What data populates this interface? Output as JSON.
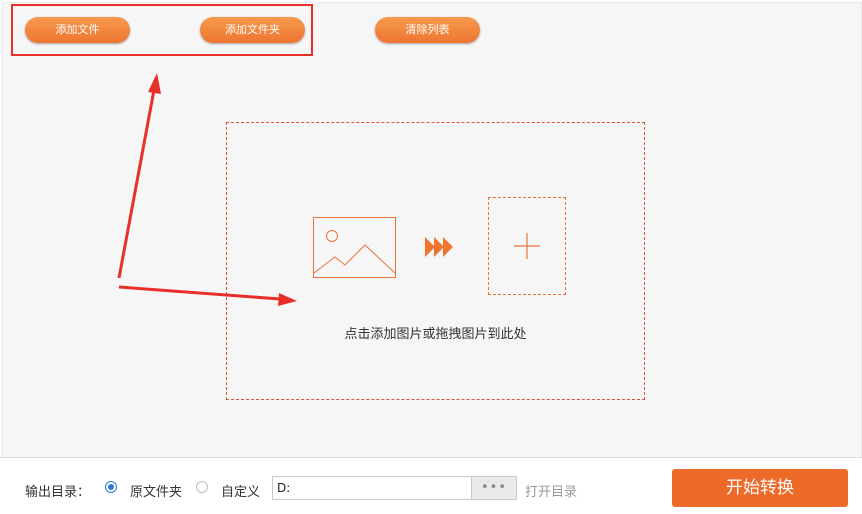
{
  "toolbar": {
    "add_file": "添加文件",
    "add_folder": "添加文件夹",
    "clear_list": "清除列表"
  },
  "dropzone": {
    "hint": "点击添加图片或拖拽图片到此处",
    "image_icon": "image-icon",
    "arrows_icon": "fast-forward-icon",
    "add_icon": "plus-icon"
  },
  "footer": {
    "output_label": "输出目录：",
    "option_original": "原文件夹",
    "option_custom": "自定义",
    "selected_option": "原文件夹",
    "path_value": "D:",
    "browse_label": "•••",
    "open_dir": "打开目录",
    "start": "开始转换"
  },
  "colors": {
    "accent": "#ee6a28",
    "annotation": "#e8302a",
    "radio": "#2a7ad8"
  }
}
